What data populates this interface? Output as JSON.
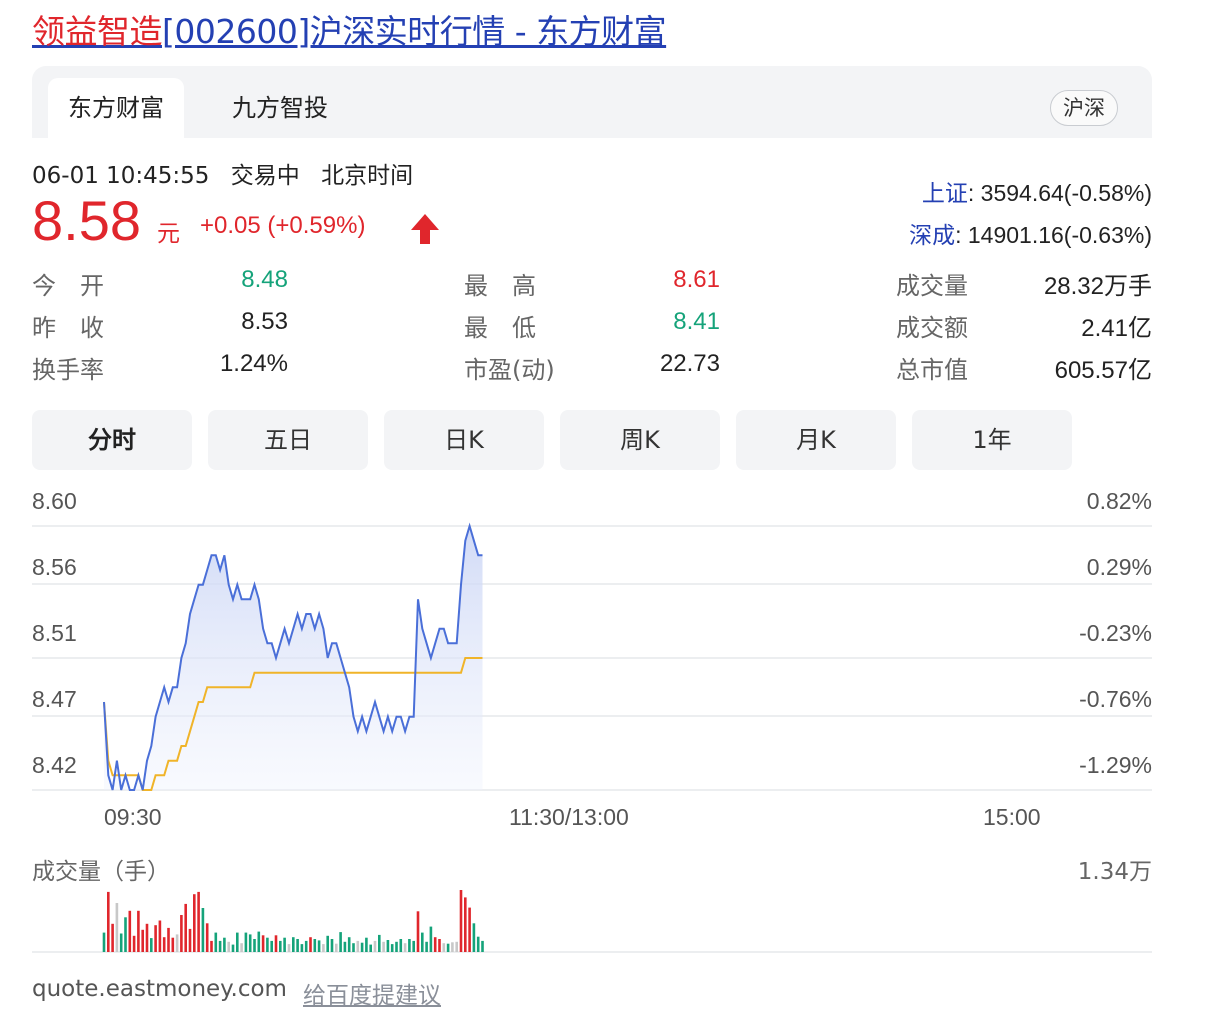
{
  "title": {
    "highlight": "领益智造",
    "rest": "[002600]沪深实时行情 - 东方财富"
  },
  "tabs": {
    "items": [
      "东方财富",
      "九方智投"
    ],
    "active": 0,
    "market_badge": "沪深"
  },
  "status": {
    "datetime": "06-01 10:45:55",
    "trading_state": "交易中",
    "timezone": "北京时间"
  },
  "quote": {
    "price": "8.58",
    "unit": "元",
    "change": "+0.05 (+0.59%)",
    "direction": "up"
  },
  "indices": [
    {
      "label": "上证",
      "value": ": 3594.64(-0.58%)"
    },
    {
      "label": "深成",
      "value": ": 14901.16(-0.63%)"
    }
  ],
  "stats": {
    "open_label": "今　开",
    "open_value": "8.48",
    "high_label": "最　高",
    "high_value": "8.61",
    "volume_label": "成交量",
    "volume_value": "28.32万手",
    "prev_close_label": "昨　收",
    "prev_close_value": "8.53",
    "low_label": "最　低",
    "low_value": "8.41",
    "amount_label": "成交额",
    "amount_value": "2.41亿",
    "turnover_label": "换手率",
    "turnover_value": "1.24%",
    "pe_label": "市盈(动)",
    "pe_value": "22.73",
    "mktcap_label": "总市值",
    "mktcap_value": "605.57亿"
  },
  "periods": {
    "items": [
      "分时",
      "五日",
      "日K",
      "周K",
      "月K",
      "1年"
    ],
    "active": 0
  },
  "colors": {
    "up": "#e0262c",
    "down": "#15a37a",
    "flat": "#c8c8c8",
    "price_line": "#4a6fd8",
    "avg_line": "#f0b429",
    "link": "#2440b3"
  },
  "chart_data": {
    "type": "line",
    "y_left_ticks": [
      "8.60",
      "8.56",
      "8.51",
      "8.47",
      "8.42"
    ],
    "y_right_ticks": [
      "0.82%",
      "0.29%",
      "-0.23%",
      "-0.76%",
      "-1.29%"
    ],
    "x_ticks": [
      "09:30",
      "11:30/13:00",
      "15:00"
    ],
    "ylim": [
      8.42,
      8.6
    ],
    "prev_close": 8.53,
    "series": [
      {
        "role": "price",
        "values": [
          8.48,
          8.43,
          8.42,
          8.44,
          8.42,
          8.43,
          8.42,
          8.42,
          8.43,
          8.42,
          8.44,
          8.45,
          8.47,
          8.48,
          8.49,
          8.48,
          8.49,
          8.49,
          8.51,
          8.52,
          8.54,
          8.55,
          8.56,
          8.56,
          8.57,
          8.58,
          8.58,
          8.57,
          8.58,
          8.56,
          8.55,
          8.56,
          8.55,
          8.55,
          8.55,
          8.56,
          8.55,
          8.53,
          8.52,
          8.52,
          8.51,
          8.52,
          8.53,
          8.52,
          8.53,
          8.54,
          8.53,
          8.54,
          8.54,
          8.53,
          8.54,
          8.53,
          8.51,
          8.52,
          8.52,
          8.51,
          8.5,
          8.49,
          8.47,
          8.46,
          8.47,
          8.46,
          8.47,
          8.48,
          8.47,
          8.46,
          8.47,
          8.46,
          8.47,
          8.47,
          8.46,
          8.47,
          8.47,
          8.55,
          8.53,
          8.52,
          8.51,
          8.52,
          8.53,
          8.53,
          8.52,
          8.52,
          8.52,
          8.56,
          8.59,
          8.6,
          8.59,
          8.58,
          8.58
        ]
      },
      {
        "role": "average",
        "values": [
          8.48,
          8.44,
          8.43,
          8.43,
          8.43,
          8.43,
          8.43,
          8.43,
          8.43,
          8.42,
          8.42,
          8.42,
          8.43,
          8.43,
          8.43,
          8.44,
          8.44,
          8.44,
          8.45,
          8.45,
          8.46,
          8.47,
          8.48,
          8.48,
          8.49,
          8.49,
          8.49,
          8.49,
          8.49,
          8.49,
          8.49,
          8.49,
          8.49,
          8.49,
          8.49,
          8.5,
          8.5,
          8.5,
          8.5,
          8.5,
          8.5,
          8.5,
          8.5,
          8.5,
          8.5,
          8.5,
          8.5,
          8.5,
          8.5,
          8.5,
          8.5,
          8.5,
          8.5,
          8.5,
          8.5,
          8.5,
          8.5,
          8.5,
          8.5,
          8.5,
          8.5,
          8.5,
          8.5,
          8.5,
          8.5,
          8.5,
          8.5,
          8.5,
          8.5,
          8.5,
          8.5,
          8.5,
          8.5,
          8.5,
          8.5,
          8.5,
          8.5,
          8.5,
          8.5,
          8.5,
          8.5,
          8.5,
          8.5,
          8.5,
          8.51,
          8.51,
          8.51,
          8.51,
          8.51
        ]
      }
    ],
    "session_minutes": 240,
    "volume": {
      "title": "成交量（手）",
      "max_label": "1.34万",
      "max": 13400,
      "bars": [
        {
          "v": 4200,
          "d": "down"
        },
        {
          "v": 13000,
          "d": "up"
        },
        {
          "v": 6100,
          "d": "up"
        },
        {
          "v": 10600,
          "d": "flat"
        },
        {
          "v": 4000,
          "d": "down"
        },
        {
          "v": 7500,
          "d": "down"
        },
        {
          "v": 8900,
          "d": "up"
        },
        {
          "v": 3500,
          "d": "up"
        },
        {
          "v": 8900,
          "d": "up"
        },
        {
          "v": 4800,
          "d": "up"
        },
        {
          "v": 6100,
          "d": "up"
        },
        {
          "v": 3000,
          "d": "down"
        },
        {
          "v": 5800,
          "d": "up"
        },
        {
          "v": 6800,
          "d": "up"
        },
        {
          "v": 3200,
          "d": "up"
        },
        {
          "v": 5200,
          "d": "up"
        },
        {
          "v": 3100,
          "d": "up"
        },
        {
          "v": 3800,
          "d": "flat"
        },
        {
          "v": 8000,
          "d": "up"
        },
        {
          "v": 10400,
          "d": "up"
        },
        {
          "v": 5000,
          "d": "up"
        },
        {
          "v": 12500,
          "d": "up"
        },
        {
          "v": 13000,
          "d": "up"
        },
        {
          "v": 9500,
          "d": "down"
        },
        {
          "v": 6200,
          "d": "up"
        },
        {
          "v": 2400,
          "d": "up"
        },
        {
          "v": 4200,
          "d": "down"
        },
        {
          "v": 2400,
          "d": "down"
        },
        {
          "v": 3100,
          "d": "down"
        },
        {
          "v": 2200,
          "d": "flat"
        },
        {
          "v": 1600,
          "d": "down"
        },
        {
          "v": 4200,
          "d": "down"
        },
        {
          "v": 1900,
          "d": "flat"
        },
        {
          "v": 4200,
          "d": "down"
        },
        {
          "v": 3800,
          "d": "down"
        },
        {
          "v": 2800,
          "d": "down"
        },
        {
          "v": 4400,
          "d": "down"
        },
        {
          "v": 3600,
          "d": "up"
        },
        {
          "v": 3100,
          "d": "down"
        },
        {
          "v": 2400,
          "d": "down"
        },
        {
          "v": 3600,
          "d": "up"
        },
        {
          "v": 2400,
          "d": "down"
        },
        {
          "v": 3100,
          "d": "down"
        },
        {
          "v": 1700,
          "d": "flat"
        },
        {
          "v": 3200,
          "d": "down"
        },
        {
          "v": 2800,
          "d": "down"
        },
        {
          "v": 1700,
          "d": "down"
        },
        {
          "v": 2400,
          "d": "down"
        },
        {
          "v": 3200,
          "d": "up"
        },
        {
          "v": 2800,
          "d": "down"
        },
        {
          "v": 2500,
          "d": "down"
        },
        {
          "v": 1700,
          "d": "flat"
        },
        {
          "v": 3500,
          "d": "down"
        },
        {
          "v": 2800,
          "d": "down"
        },
        {
          "v": 1800,
          "d": "flat"
        },
        {
          "v": 4300,
          "d": "down"
        },
        {
          "v": 2200,
          "d": "down"
        },
        {
          "v": 3200,
          "d": "down"
        },
        {
          "v": 1900,
          "d": "down"
        },
        {
          "v": 2400,
          "d": "flat"
        },
        {
          "v": 2000,
          "d": "down"
        },
        {
          "v": 3100,
          "d": "down"
        },
        {
          "v": 1600,
          "d": "down"
        },
        {
          "v": 2400,
          "d": "flat"
        },
        {
          "v": 3700,
          "d": "down"
        },
        {
          "v": 2200,
          "d": "flat"
        },
        {
          "v": 2600,
          "d": "down"
        },
        {
          "v": 1700,
          "d": "down"
        },
        {
          "v": 2200,
          "d": "down"
        },
        {
          "v": 2800,
          "d": "down"
        },
        {
          "v": 1900,
          "d": "flat"
        },
        {
          "v": 2800,
          "d": "down"
        },
        {
          "v": 2400,
          "d": "down"
        },
        {
          "v": 8800,
          "d": "up"
        },
        {
          "v": 4200,
          "d": "down"
        },
        {
          "v": 2200,
          "d": "down"
        },
        {
          "v": 5500,
          "d": "down"
        },
        {
          "v": 3200,
          "d": "up"
        },
        {
          "v": 2800,
          "d": "up"
        },
        {
          "v": 1900,
          "d": "flat"
        },
        {
          "v": 1800,
          "d": "down"
        },
        {
          "v": 2100,
          "d": "flat"
        },
        {
          "v": 2200,
          "d": "flat"
        },
        {
          "v": 13400,
          "d": "up"
        },
        {
          "v": 11800,
          "d": "up"
        },
        {
          "v": 9600,
          "d": "up"
        },
        {
          "v": 6200,
          "d": "down"
        },
        {
          "v": 3300,
          "d": "down"
        },
        {
          "v": 2400,
          "d": "down"
        }
      ]
    }
  },
  "footer": {
    "domain": "quote.eastmoney.com",
    "feedback": "给百度提建议"
  }
}
